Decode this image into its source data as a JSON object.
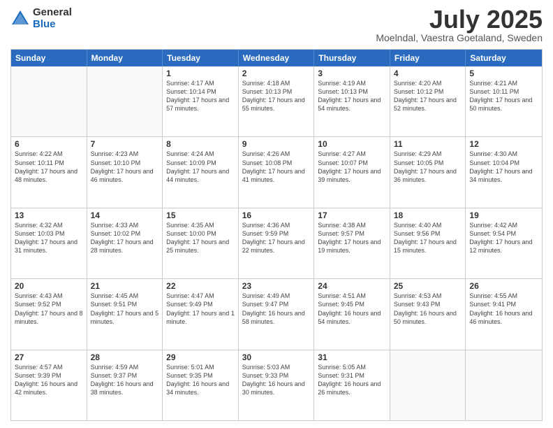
{
  "logo": {
    "general": "General",
    "blue": "Blue"
  },
  "title": {
    "month": "July 2025",
    "location": "Moelndal, Vaestra Goetaland, Sweden"
  },
  "weekdays": [
    "Sunday",
    "Monday",
    "Tuesday",
    "Wednesday",
    "Thursday",
    "Friday",
    "Saturday"
  ],
  "weeks": [
    [
      {
        "day": "",
        "text": ""
      },
      {
        "day": "",
        "text": ""
      },
      {
        "day": "1",
        "text": "Sunrise: 4:17 AM\nSunset: 10:14 PM\nDaylight: 17 hours and 57 minutes."
      },
      {
        "day": "2",
        "text": "Sunrise: 4:18 AM\nSunset: 10:13 PM\nDaylight: 17 hours and 55 minutes."
      },
      {
        "day": "3",
        "text": "Sunrise: 4:19 AM\nSunset: 10:13 PM\nDaylight: 17 hours and 54 minutes."
      },
      {
        "day": "4",
        "text": "Sunrise: 4:20 AM\nSunset: 10:12 PM\nDaylight: 17 hours and 52 minutes."
      },
      {
        "day": "5",
        "text": "Sunrise: 4:21 AM\nSunset: 10:11 PM\nDaylight: 17 hours and 50 minutes."
      }
    ],
    [
      {
        "day": "6",
        "text": "Sunrise: 4:22 AM\nSunset: 10:11 PM\nDaylight: 17 hours and 48 minutes."
      },
      {
        "day": "7",
        "text": "Sunrise: 4:23 AM\nSunset: 10:10 PM\nDaylight: 17 hours and 46 minutes."
      },
      {
        "day": "8",
        "text": "Sunrise: 4:24 AM\nSunset: 10:09 PM\nDaylight: 17 hours and 44 minutes."
      },
      {
        "day": "9",
        "text": "Sunrise: 4:26 AM\nSunset: 10:08 PM\nDaylight: 17 hours and 41 minutes."
      },
      {
        "day": "10",
        "text": "Sunrise: 4:27 AM\nSunset: 10:07 PM\nDaylight: 17 hours and 39 minutes."
      },
      {
        "day": "11",
        "text": "Sunrise: 4:29 AM\nSunset: 10:05 PM\nDaylight: 17 hours and 36 minutes."
      },
      {
        "day": "12",
        "text": "Sunrise: 4:30 AM\nSunset: 10:04 PM\nDaylight: 17 hours and 34 minutes."
      }
    ],
    [
      {
        "day": "13",
        "text": "Sunrise: 4:32 AM\nSunset: 10:03 PM\nDaylight: 17 hours and 31 minutes."
      },
      {
        "day": "14",
        "text": "Sunrise: 4:33 AM\nSunset: 10:02 PM\nDaylight: 17 hours and 28 minutes."
      },
      {
        "day": "15",
        "text": "Sunrise: 4:35 AM\nSunset: 10:00 PM\nDaylight: 17 hours and 25 minutes."
      },
      {
        "day": "16",
        "text": "Sunrise: 4:36 AM\nSunset: 9:59 PM\nDaylight: 17 hours and 22 minutes."
      },
      {
        "day": "17",
        "text": "Sunrise: 4:38 AM\nSunset: 9:57 PM\nDaylight: 17 hours and 19 minutes."
      },
      {
        "day": "18",
        "text": "Sunrise: 4:40 AM\nSunset: 9:56 PM\nDaylight: 17 hours and 15 minutes."
      },
      {
        "day": "19",
        "text": "Sunrise: 4:42 AM\nSunset: 9:54 PM\nDaylight: 17 hours and 12 minutes."
      }
    ],
    [
      {
        "day": "20",
        "text": "Sunrise: 4:43 AM\nSunset: 9:52 PM\nDaylight: 17 hours and 8 minutes."
      },
      {
        "day": "21",
        "text": "Sunrise: 4:45 AM\nSunset: 9:51 PM\nDaylight: 17 hours and 5 minutes."
      },
      {
        "day": "22",
        "text": "Sunrise: 4:47 AM\nSunset: 9:49 PM\nDaylight: 17 hours and 1 minute."
      },
      {
        "day": "23",
        "text": "Sunrise: 4:49 AM\nSunset: 9:47 PM\nDaylight: 16 hours and 58 minutes."
      },
      {
        "day": "24",
        "text": "Sunrise: 4:51 AM\nSunset: 9:45 PM\nDaylight: 16 hours and 54 minutes."
      },
      {
        "day": "25",
        "text": "Sunrise: 4:53 AM\nSunset: 9:43 PM\nDaylight: 16 hours and 50 minutes."
      },
      {
        "day": "26",
        "text": "Sunrise: 4:55 AM\nSunset: 9:41 PM\nDaylight: 16 hours and 46 minutes."
      }
    ],
    [
      {
        "day": "27",
        "text": "Sunrise: 4:57 AM\nSunset: 9:39 PM\nDaylight: 16 hours and 42 minutes."
      },
      {
        "day": "28",
        "text": "Sunrise: 4:59 AM\nSunset: 9:37 PM\nDaylight: 16 hours and 38 minutes."
      },
      {
        "day": "29",
        "text": "Sunrise: 5:01 AM\nSunset: 9:35 PM\nDaylight: 16 hours and 34 minutes."
      },
      {
        "day": "30",
        "text": "Sunrise: 5:03 AM\nSunset: 9:33 PM\nDaylight: 16 hours and 30 minutes."
      },
      {
        "day": "31",
        "text": "Sunrise: 5:05 AM\nSunset: 9:31 PM\nDaylight: 16 hours and 26 minutes."
      },
      {
        "day": "",
        "text": ""
      },
      {
        "day": "",
        "text": ""
      }
    ]
  ]
}
